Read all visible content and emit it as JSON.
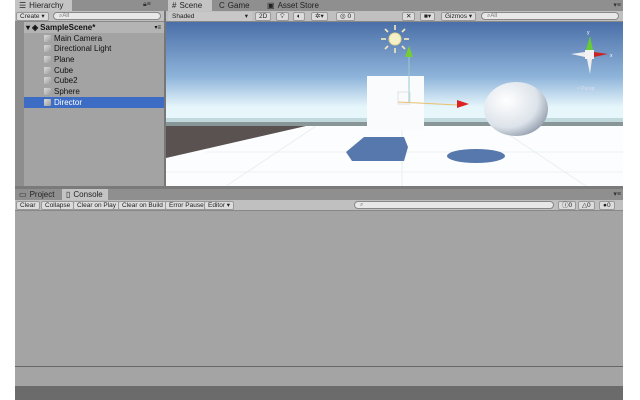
{
  "hierarchy": {
    "tab": "Hierarchy",
    "create": "Create ▾",
    "search_placeholder": "All",
    "scene": "SampleScene*",
    "items": [
      "Main Camera",
      "Directional Light",
      "Plane",
      "Cube",
      "Cube2",
      "Sphere",
      "Director"
    ],
    "selected": "Director"
  },
  "scene_tabs": [
    {
      "label": "Scene",
      "icon": "#"
    },
    {
      "label": "Game",
      "icon": "C"
    },
    {
      "label": "Asset Store",
      "icon": "▣"
    }
  ],
  "scene_toolbar": {
    "shading": "Shaded",
    "mode2d": "2D",
    "hidden_count": "0",
    "gizmos": "Gizmos",
    "search_placeholder": "All"
  },
  "gizmo_axes": {
    "y": "y",
    "x": "x",
    "persp": "< Persp"
  },
  "console": {
    "tabs": [
      "Project",
      "Console"
    ],
    "buttons": [
      "Clear",
      "Collapse",
      "Clear on Play",
      "Clear on Build",
      "Error Pause",
      "Editor ▾"
    ],
    "counts": {
      "info": "0",
      "warning": "0",
      "error": "0"
    }
  },
  "colors": {
    "selection": "#3d6cc4",
    "panel": "#a4a4a4"
  }
}
